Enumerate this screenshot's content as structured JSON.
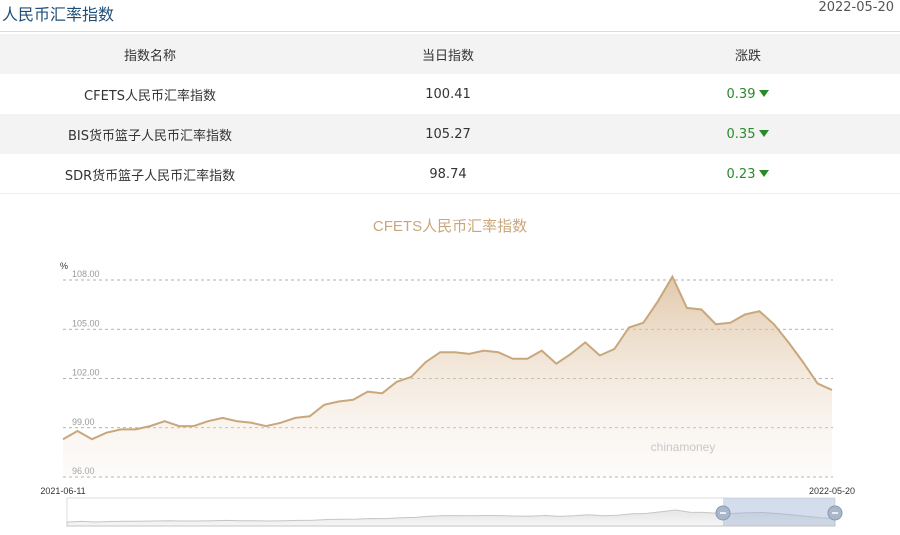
{
  "header": {
    "title": "人民币汇率指数",
    "date": "2022-05-20"
  },
  "table": {
    "columns": [
      "指数名称",
      "当日指数",
      "涨跌"
    ],
    "rows": [
      {
        "name": "CFETS人民币汇率指数",
        "value": "100.41",
        "change": "0.39"
      },
      {
        "name": "BIS货币篮子人民币汇率指数",
        "value": "105.27",
        "change": "0.35"
      },
      {
        "name": "SDR货币篮子人民币汇率指数",
        "value": "98.74",
        "change": "0.23"
      }
    ]
  },
  "colors": {
    "line": "#c9a77c",
    "title": "#c9a77c",
    "down": "#2a8a2a"
  },
  "chart_data": {
    "type": "area",
    "title": "CFETS人民币汇率指数",
    "ylabel": "%",
    "ylim": [
      96,
      108
    ],
    "yticks": [
      "108.00",
      "105.00",
      "102.00",
      "99.00",
      "96.00"
    ],
    "x_start": "2021-06-11",
    "x_end": "2022-05-20",
    "watermark": "chinamoney",
    "grid": true,
    "series": [
      {
        "values": [
          98.3,
          98.8,
          98.3,
          98.7,
          98.9,
          98.9,
          99.1,
          99.4,
          99.1,
          99.1,
          99.4,
          99.6,
          99.4,
          99.3,
          99.1,
          99.3,
          99.6,
          99.7,
          100.4,
          100.6,
          100.7,
          101.2,
          101.1,
          101.8,
          102.1,
          103.0,
          103.6,
          103.6,
          103.5,
          103.7,
          103.6,
          103.2,
          103.2,
          103.7,
          102.9,
          103.5,
          104.2,
          103.4,
          103.8,
          105.1,
          105.4,
          106.7,
          108.2,
          106.3,
          106.2,
          105.3,
          105.4,
          105.9,
          106.1,
          105.3,
          104.2,
          103.0,
          101.7,
          101.3
        ]
      }
    ]
  }
}
